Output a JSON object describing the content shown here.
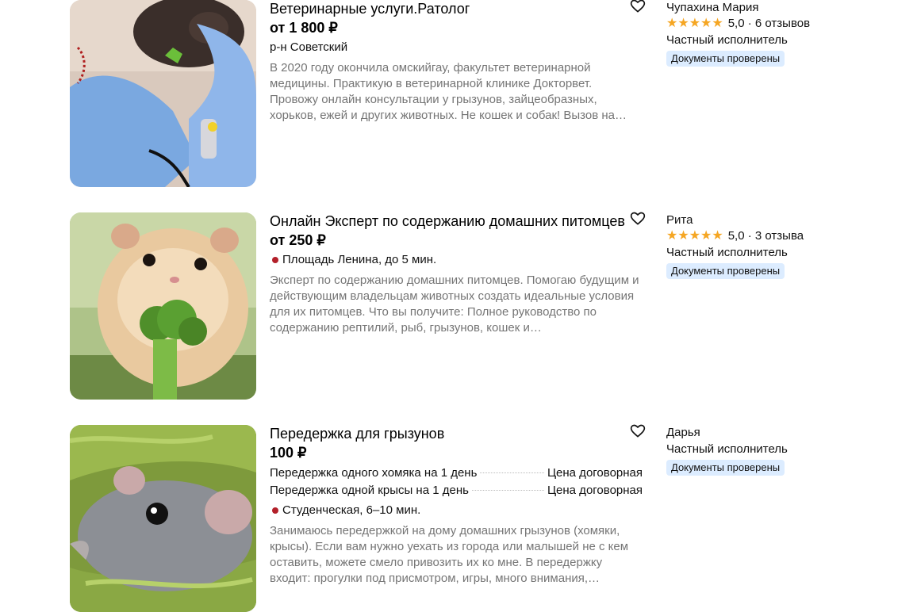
{
  "listings": [
    {
      "title": "Ветеринарные услуги.Ратолог",
      "price": "от 1 800 ₽",
      "location": "р-н Советский",
      "description": "В 2020 году окончила омскийгау, факультет ветеринарной медицины. Практикую в ветеринарной клинике Докторвет. Провожу онлайн консультации у грызунов, зайцеобразных, хорьков, ежей и других животных. Не кошек и собак! Вызов на…",
      "seller": {
        "name": "Чупахина Мария",
        "rating": "5,0",
        "reviews": "· 6 отзывов",
        "type": "Частный исполнитель",
        "badge": "Документы проверены"
      }
    },
    {
      "title": "Онлайн Эксперт по содержанию домашних питомцев",
      "price": "от 250 ₽",
      "location": "Площадь Ленина, до 5 мин.",
      "description": "Эксперт по содержанию домашних питомцев. Помогаю будущим и действующим владельцам животных создать идеальные условия для их питомцев. Что вы получите: Полное руководство по содержанию рептилий, рыб, грызунов, кошек и…",
      "seller": {
        "name": "Рита",
        "rating": "5,0",
        "reviews": "· 3 отзыва",
        "type": "Частный исполнитель",
        "badge": "Документы проверены"
      }
    },
    {
      "title": "Передержка для грызунов",
      "price": "100 ₽",
      "services": [
        {
          "name": "Передержка одного хомяка на 1 день",
          "price": "Цена договорная"
        },
        {
          "name": "Передержка одной крысы на 1 день",
          "price": "Цена договорная"
        }
      ],
      "location": "Студенческая, 6–10 мин.",
      "description": "Занимаюсь передержкой на дому домашних грызунов (хомяки, крысы). Если вам нужно уехать из города или малышей не с кем оставить, можете смело привозить их ко мне. В передержку входит: прогулки под присмотром, игры, много внимания,…",
      "seller": {
        "name": "Дарья",
        "type": "Частный исполнитель",
        "badge": "Документы проверены"
      }
    }
  ],
  "icons": {
    "favorite": "heart-outline-icon",
    "metro": "metro-dot-icon",
    "star": "star-icon"
  },
  "colors": {
    "metro_dot": "#b3202a",
    "star": "#f5a623",
    "badge_bg": "#dcecff",
    "desc_text": "#757575"
  }
}
